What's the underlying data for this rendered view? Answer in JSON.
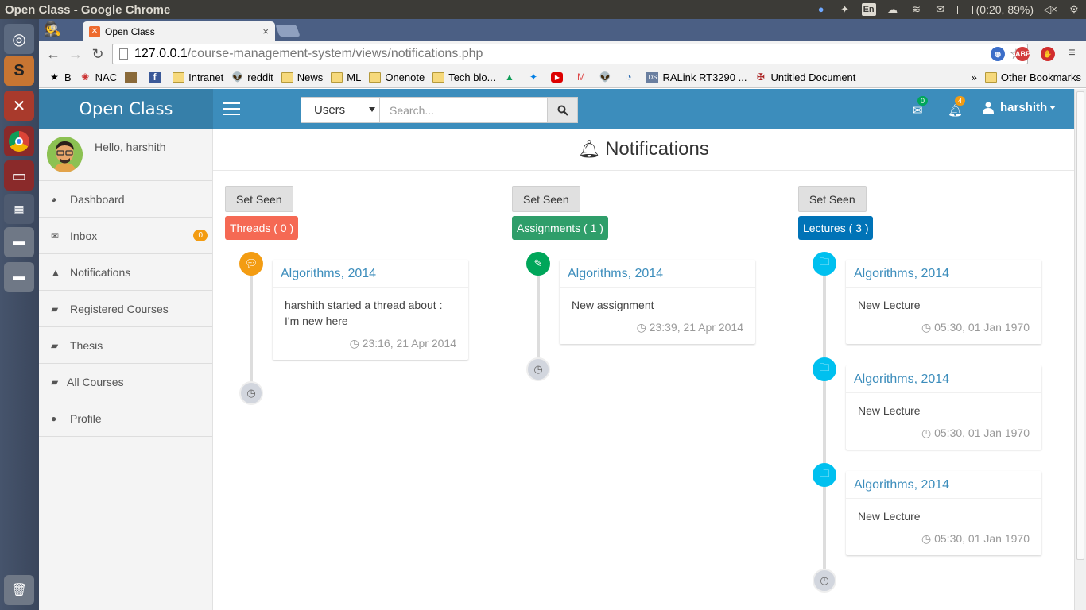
{
  "os": {
    "window_title": "Open Class - Google Chrome",
    "lang": "En",
    "battery": "(0:20, 89%)"
  },
  "browser": {
    "tab_title": "Open Class",
    "url_host": "127.0.0.1",
    "url_path": "/course-management-system/views/notifications.php",
    "bookmarks": [
      "B",
      "NAC",
      "Intranet",
      "reddit",
      "News",
      "ML",
      "Onenote",
      "Tech blo...",
      "RALink RT3290 ...",
      "Untitled Document"
    ],
    "bookmarks_overflow": "»",
    "other_bookmarks": "Other Bookmarks"
  },
  "app": {
    "brand": "Open Class",
    "search_filter": "Users",
    "search_placeholder": "Search...",
    "mail_count": "0",
    "notif_count": "4",
    "username": "harshith",
    "hello": "Hello, harshith"
  },
  "sidebar": {
    "items": [
      {
        "label": "Dashboard",
        "icon": "dashboard-icon"
      },
      {
        "label": "Inbox",
        "icon": "envelope-icon",
        "badge": "0"
      },
      {
        "label": "Notifications",
        "icon": "bell-icon"
      },
      {
        "label": "Registered Courses",
        "icon": "book-icon"
      },
      {
        "label": "Thesis",
        "icon": "book-icon"
      },
      {
        "label": "All Courses",
        "icon": "book-icon"
      },
      {
        "label": "Profile",
        "icon": "user-icon"
      }
    ]
  },
  "content": {
    "title": "Notifications",
    "columns": [
      {
        "set_seen": "Set Seen",
        "label": "Threads ( 0 )",
        "color": "#f56954",
        "icon_color": "#f39c12",
        "items": [
          {
            "title": "Algorithms, 2014",
            "body": "harshith started a thread about : I'm new here",
            "time": "23:16, 21 Apr 2014"
          }
        ]
      },
      {
        "set_seen": "Set Seen",
        "label": "Assignments ( 1 )",
        "color": "#2f9e6a",
        "icon_color": "#00a65a",
        "items": [
          {
            "title": "Algorithms, 2014",
            "body": "New assignment",
            "time": "23:39, 21 Apr 2014"
          }
        ]
      },
      {
        "set_seen": "Set Seen",
        "label": "Lectures ( 3 )",
        "color": "#0073b7",
        "icon_color": "#00c0ef",
        "items": [
          {
            "title": "Algorithms, 2014",
            "body": "New Lecture",
            "time": "05:30, 01 Jan 1970"
          },
          {
            "title": "Algorithms, 2014",
            "body": "New Lecture",
            "time": "05:30, 01 Jan 1970"
          },
          {
            "title": "Algorithms, 2014",
            "body": "New Lecture",
            "time": "05:30, 01 Jan 1970"
          }
        ]
      }
    ]
  }
}
